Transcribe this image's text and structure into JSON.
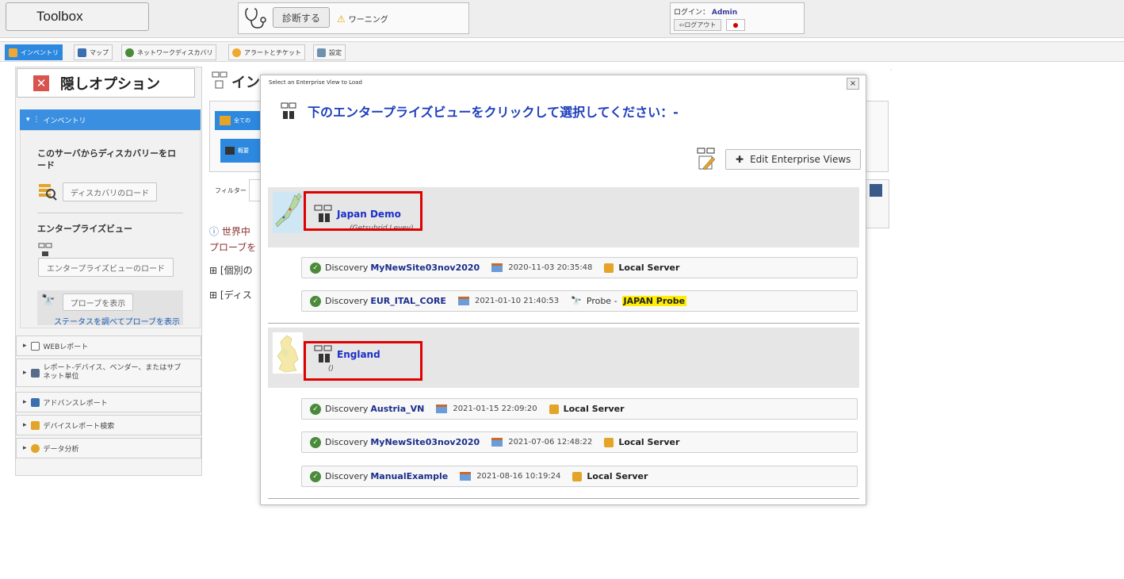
{
  "header": {
    "toolbox_label": "Toolbox",
    "diagnose_label": "診断する",
    "warning_label": "ワーニング",
    "login_label": "ログイン：",
    "login_user": "Admin",
    "logout_label": "ログアウト"
  },
  "tabs": [
    {
      "label": "インベントリ",
      "icon": "inventory-icon",
      "active": true
    },
    {
      "label": "マップ",
      "icon": "map-icon",
      "active": false
    },
    {
      "label": "ネットワークディスカバリ",
      "icon": "network-discovery-icon",
      "active": false
    },
    {
      "label": "アラートとチケット",
      "icon": "alert-icon",
      "active": false
    },
    {
      "label": "設定",
      "icon": "settings-icon",
      "active": false
    }
  ],
  "sidebar": {
    "hide_options_label": "隠しオプション",
    "inventory_header": "インベントリ",
    "discovery_title": "このサーバからディスカバリーをロード",
    "load_discovery_button": "ディスカバリのロード",
    "enterprise_view_title": "エンタープライズビュー",
    "load_enterprise_view_button": "エンタープライズビューのロード",
    "show_probes_button": "プローブを表示",
    "probe_status_link": "ステータスを調べてプローブを表示",
    "menu_items": [
      {
        "label": "WEBレポート",
        "icon": "web-report-icon"
      },
      {
        "label": "レポート-デバイス、ベンダー、またはサブネット単位",
        "icon": "report-icon"
      },
      {
        "label": "アドバンスレポート",
        "icon": "advanced-report-icon"
      },
      {
        "label": "デバイスレポート検索",
        "icon": "device-search-icon"
      },
      {
        "label": "データ分析",
        "icon": "data-analysis-icon"
      }
    ]
  },
  "background": {
    "main_title_fragment": "イン",
    "all_fragment": "全ての",
    "overview_fragment": "概要",
    "filter_label": "フィルター",
    "info_fragment_1": "世界中",
    "info_fragment_2": "プローブを",
    "link_fragment_1": "[個別の",
    "link_fragment_2": "[ディス"
  },
  "modal": {
    "title": "Select an Enterprise View to Load",
    "close_label": "×",
    "heading": "下のエンタープライズビューをクリックして選択してください：-",
    "edit_button_label": "Edit Enterprise Views",
    "enterprise_views": [
      {
        "name": "Japan Demo",
        "subtitle": "(Getsubrid Levev)",
        "map_icon": "japan-map-thumbnail",
        "discoveries": [
          {
            "prefix": "Discovery",
            "name": "MyNewSite03nov2020",
            "date": "2020-11-03 20:35:48",
            "source_type": "server",
            "source_label": "Local Server"
          },
          {
            "prefix": "Discovery",
            "name": "EUR_ITAL_CORE",
            "date": "2021-01-10 21:40:53",
            "source_type": "probe",
            "source_prefix": "Probe -",
            "source_label": "JAPAN Probe"
          }
        ]
      },
      {
        "name": "England",
        "subtitle": "()",
        "map_icon": "england-map-thumbnail",
        "discoveries": [
          {
            "prefix": "Discovery",
            "name": "Austria_VN",
            "date": "2021-01-15 22:09:20",
            "source_type": "server",
            "source_label": "Local Server"
          },
          {
            "prefix": "Discovery",
            "name": "MyNewSite03nov2020",
            "date": "2021-07-06 12:48:22",
            "source_type": "server",
            "source_label": "Local Server"
          },
          {
            "prefix": "Discovery",
            "name": "ManualExample",
            "date": "2021-08-16 10:19:24",
            "source_type": "server",
            "source_label": "Local Server"
          }
        ]
      }
    ]
  },
  "colors": {
    "accent": "#2d89e0",
    "heading_blue": "#1e3fbd",
    "highlight_box": "#e00000",
    "probe_highlight": "#ffee00"
  }
}
